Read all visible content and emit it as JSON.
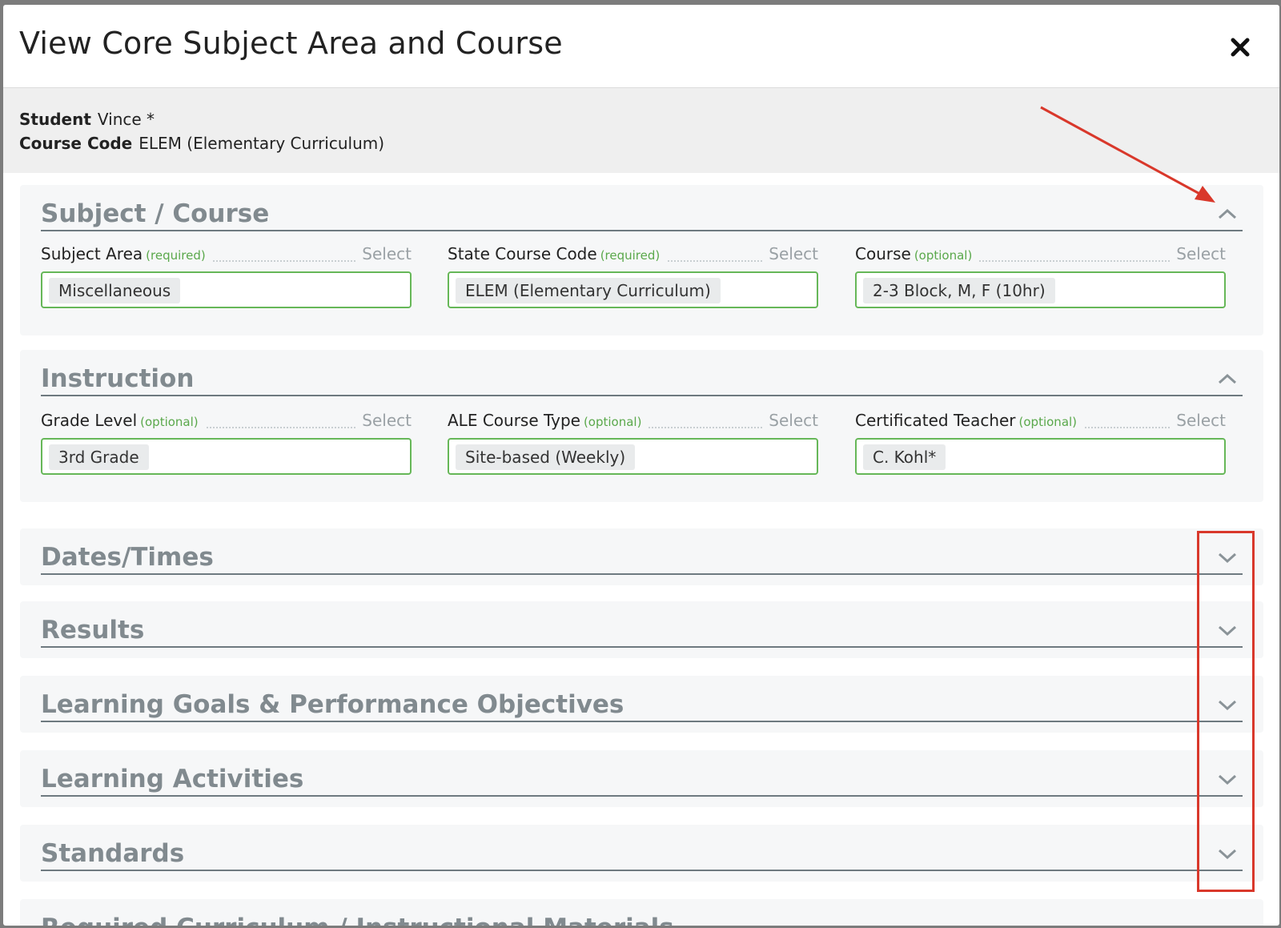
{
  "modal": {
    "title": "View Core Subject Area and Course"
  },
  "info": {
    "student_label": "Student",
    "student_value": "Vince *",
    "course_code_label": "Course Code",
    "course_code_value": "ELEM (Elementary Curriculum)"
  },
  "sections": {
    "subject_course": {
      "title": "Subject / Course",
      "fields": [
        {
          "label": "Subject Area",
          "tag": "(required)",
          "select": "Select",
          "value": "Miscellaneous"
        },
        {
          "label": "State Course Code",
          "tag": "(required)",
          "select": "Select",
          "value": "ELEM (Elementary Curriculum)"
        },
        {
          "label": "Course",
          "tag": "(optional)",
          "select": "Select",
          "value": "2-3 Block, M, F (10hr)"
        }
      ]
    },
    "instruction": {
      "title": "Instruction",
      "fields": [
        {
          "label": "Grade Level",
          "tag": "(optional)",
          "select": "Select",
          "value": "3rd Grade"
        },
        {
          "label": "ALE Course Type",
          "tag": "(optional)",
          "select": "Select",
          "value": "Site-based (Weekly)"
        },
        {
          "label": "Certificated Teacher",
          "tag": "(optional)",
          "select": "Select",
          "value": "C. Kohl*"
        }
      ]
    },
    "dates_times": {
      "title": "Dates/Times"
    },
    "results": {
      "title": "Results"
    },
    "learning_goals": {
      "title": "Learning Goals & Performance Objectives"
    },
    "learning_activities": {
      "title": "Learning Activities"
    },
    "standards": {
      "title": "Standards"
    },
    "required_curriculum": {
      "title": "Required Curriculum / Instructional Materials"
    }
  },
  "icons": {
    "close": "close-icon",
    "expanded": "chevron-up-icon",
    "collapsed": "chevron-down-icon"
  },
  "colors": {
    "field_border": "#66b758",
    "tag_text": "#5aa84b",
    "section_title": "#818a8f",
    "annotation": "#d9382b"
  }
}
